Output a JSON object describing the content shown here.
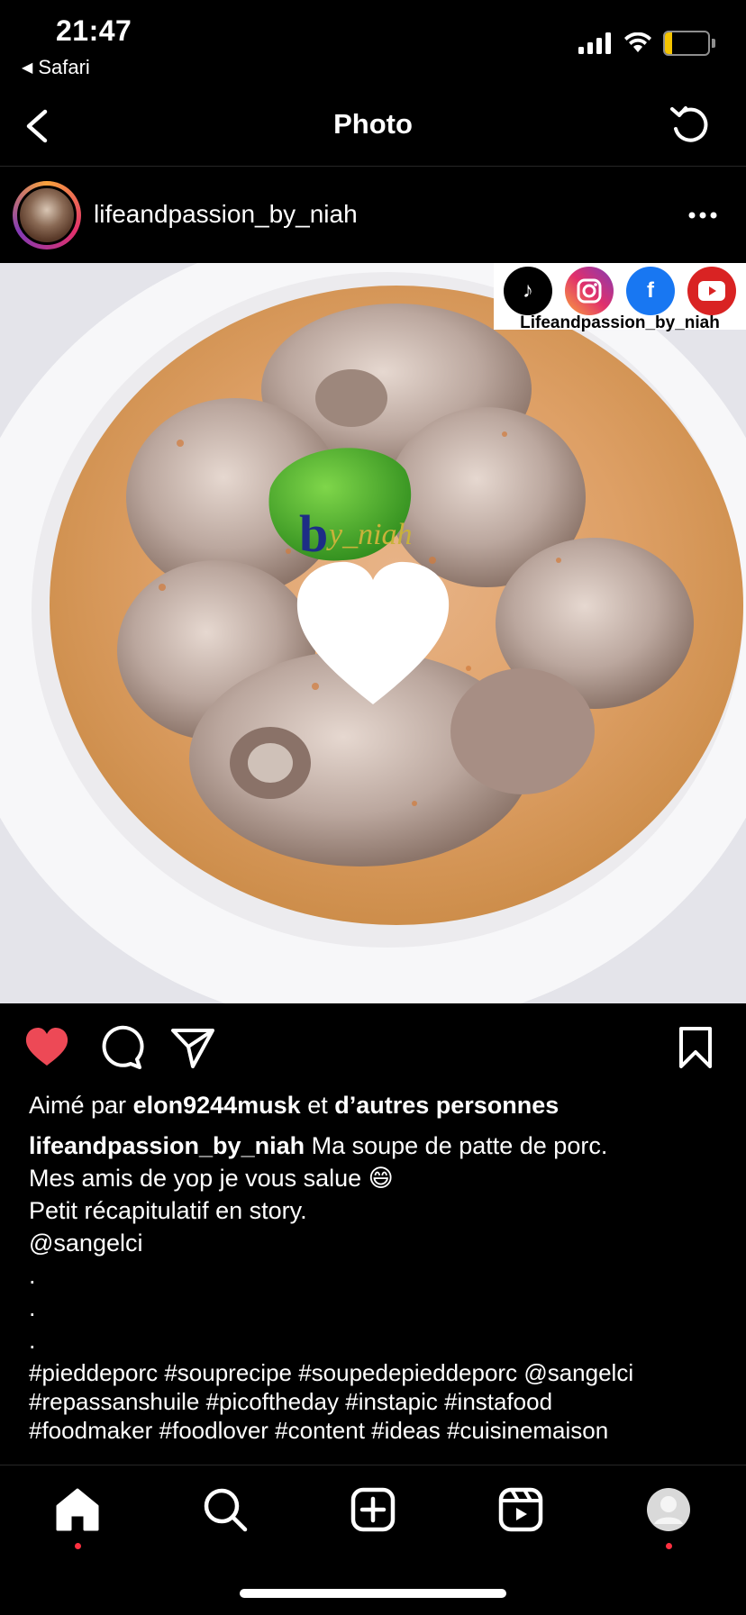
{
  "status_bar": {
    "time": "21:47",
    "back_app": "Safari",
    "battery_level": "10"
  },
  "nav": {
    "title": "Photo",
    "back_icon": "chevron-left-icon",
    "refresh_icon": "refresh-icon"
  },
  "post": {
    "username": "lifeandpassion_by_niah",
    "more_icon": "ellipsis-icon",
    "photo_alt": "Soupe de patte de porc",
    "watermark": "by_niah",
    "social_handle": "Lifeandpassion_by_niah",
    "social_icons": [
      "tiktok-icon",
      "instagram-icon",
      "facebook-icon",
      "youtube-icon"
    ]
  },
  "actions": {
    "liked": true,
    "like_color": "#ed4956"
  },
  "likes": {
    "prefix": "Aimé par",
    "user": "elon9244musk",
    "joiner": "et",
    "others": "d’autres personnes"
  },
  "caption": {
    "user": "lifeandpassion_by_niah",
    "text_first": "Ma soupe de patte de porc.",
    "lines": [
      "Mes amis de yop je vous salue 😄",
      "Petit récapitulatif en story.",
      "@sangelci",
      ".",
      ".",
      "."
    ],
    "hashtag_lines": [
      "#pieddeporc #souprecipe #soupedepieddeporc @sangelci",
      "#repassanshuile #picoftheday #instapic #instafood",
      "#foodmaker #foodlover #content #ideas #cuisinemaison"
    ]
  },
  "tabbar": {
    "tabs": [
      "home-icon",
      "search-icon",
      "create-icon",
      "reels-icon",
      "profile-icon"
    ],
    "notification_color": "#ff3040"
  }
}
